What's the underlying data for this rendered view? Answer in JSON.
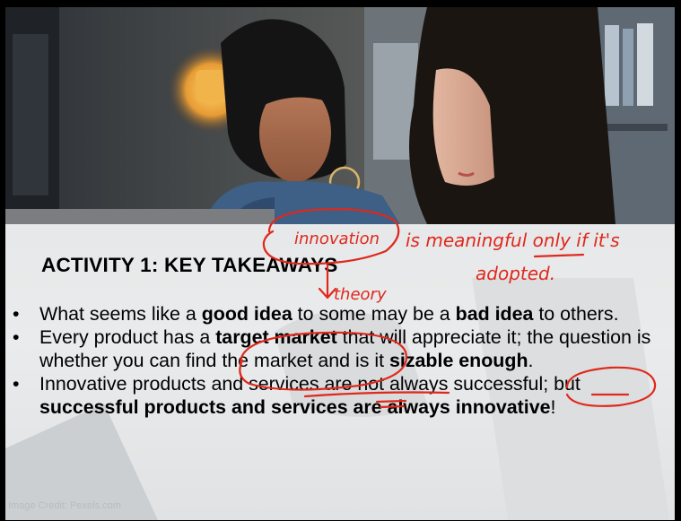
{
  "slide": {
    "title": "ACTIVITY 1: KEY TAKEAWAYS",
    "bullets": [
      {
        "parts": [
          {
            "t": "What seems like a ",
            "b": false
          },
          {
            "t": "good idea",
            "b": true
          },
          {
            "t": " to some may be a ",
            "b": false
          },
          {
            "t": "bad idea",
            "b": true
          },
          {
            "t": " to others.",
            "b": false
          }
        ]
      },
      {
        "parts": [
          {
            "t": "Every product has a ",
            "b": false
          },
          {
            "t": "target market",
            "b": true
          },
          {
            "t": " that will appreciate it;  the question is whether you can find the market and is it ",
            "b": false
          },
          {
            "t": "sizable enough",
            "b": true
          },
          {
            "t": ".",
            "b": false
          }
        ]
      },
      {
        "parts": [
          {
            "t": "Innovative products and services are not always successful; but ",
            "b": false
          },
          {
            "t": "successful products and services are always innovative",
            "b": true
          },
          {
            "t": "!",
            "b": false
          }
        ]
      }
    ],
    "image_credit": "Image Credit: Pexels.com"
  },
  "annotations": {
    "innovation": "innovation",
    "theory": "theory",
    "meaningful_line": "is meaningful only if it's",
    "adopted": "adopted.",
    "ink_color": "#e0281c"
  },
  "colors": {
    "panel": "#f0f1f2",
    "text": "#000000",
    "ink": "#e0281c"
  }
}
